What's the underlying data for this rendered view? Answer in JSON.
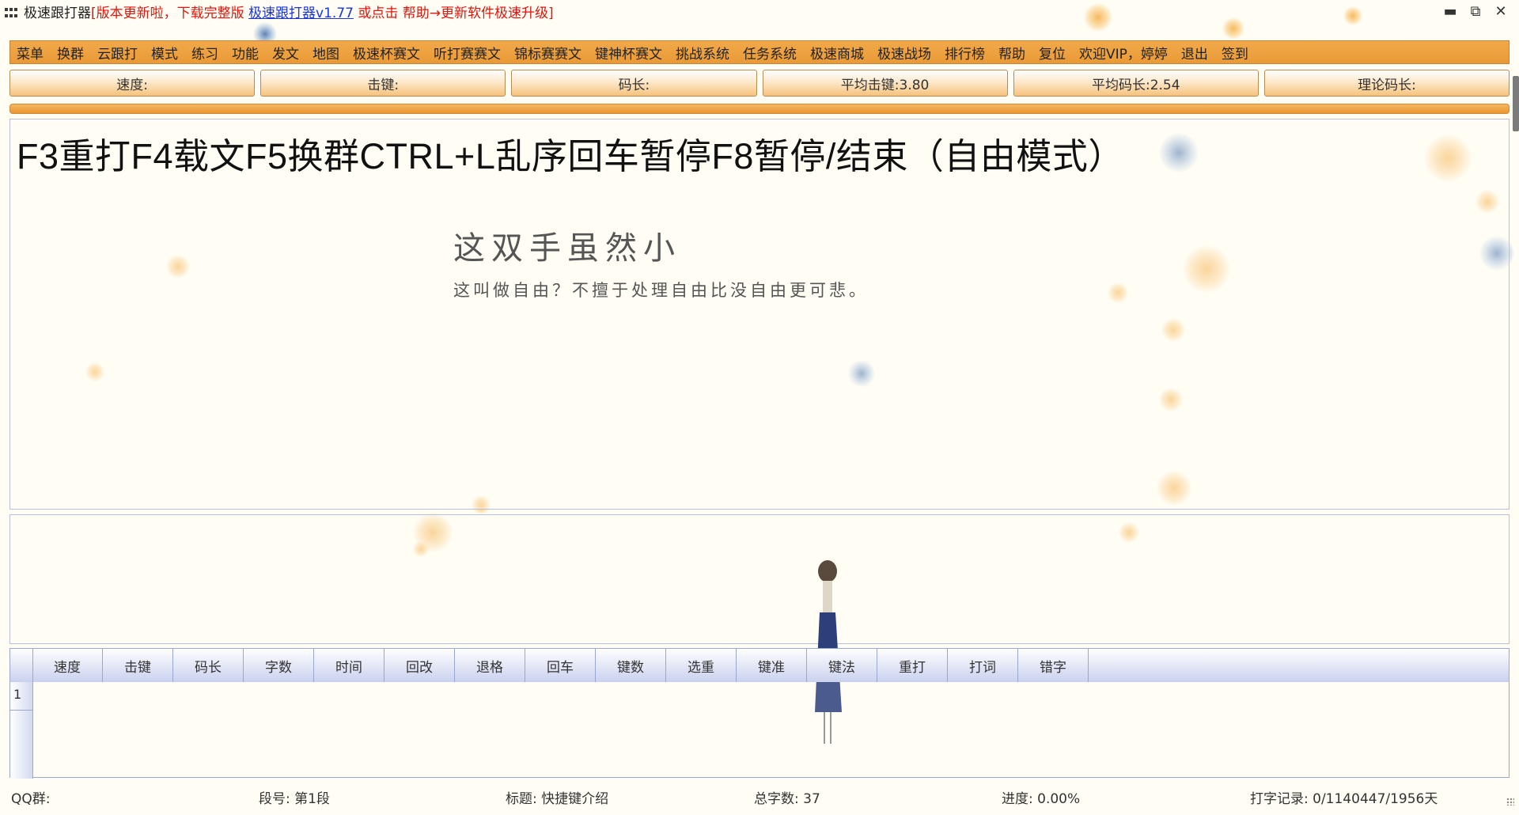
{
  "window": {
    "app_name": "极速跟打器",
    "notice_prefix": "[版本更新啦，下载完整版 ",
    "notice_link": "极速跟打器v1.77",
    "notice_suffix": " 或点击 帮助→更新软件极速升级]",
    "controls": [
      "▬",
      "⧉",
      "✕"
    ]
  },
  "menu": [
    "菜单",
    "换群",
    "云跟打",
    "模式",
    "练习",
    "功能",
    "发文",
    "地图",
    "极速杯赛文",
    "听打赛赛文",
    "锦标赛赛文",
    "键神杯赛文",
    "挑战系统",
    "任务系统",
    "极速商城",
    "极速战场",
    "排行榜",
    "帮助",
    "复位",
    "欢迎VIP，婷婷",
    "退出",
    "签到"
  ],
  "stats": [
    "速度:",
    "击键:",
    "码长:",
    "平均击键:3.80",
    "平均码长:2.54",
    "理论码长:"
  ],
  "progress_percent": 100,
  "text_panel": {
    "hotkeys": "F3重打F4载文F5换群CTRL+L乱序回车暂停F8暂停/结束（自由模式）",
    "poem_line1": "这双手虽然小",
    "poem_line2": "这叫做自由？不擅于处理自由比没自由更可悲。"
  },
  "records": {
    "columns": [
      "速度",
      "击键",
      "码长",
      "字数",
      "时间",
      "回改",
      "退格",
      "回车",
      "键数",
      "选重",
      "键准",
      "键法",
      "重打",
      "打词",
      "错字"
    ],
    "row_numbers": [
      "1"
    ]
  },
  "status": {
    "qq_group": "QQ群:",
    "paragraph": "段号: 第1段",
    "title": "标题: 快捷键介绍",
    "total_chars": "总字数: 37",
    "progress": "进度: 0.00%",
    "typing_record": "打字记录: 0/1140447/1956天"
  }
}
